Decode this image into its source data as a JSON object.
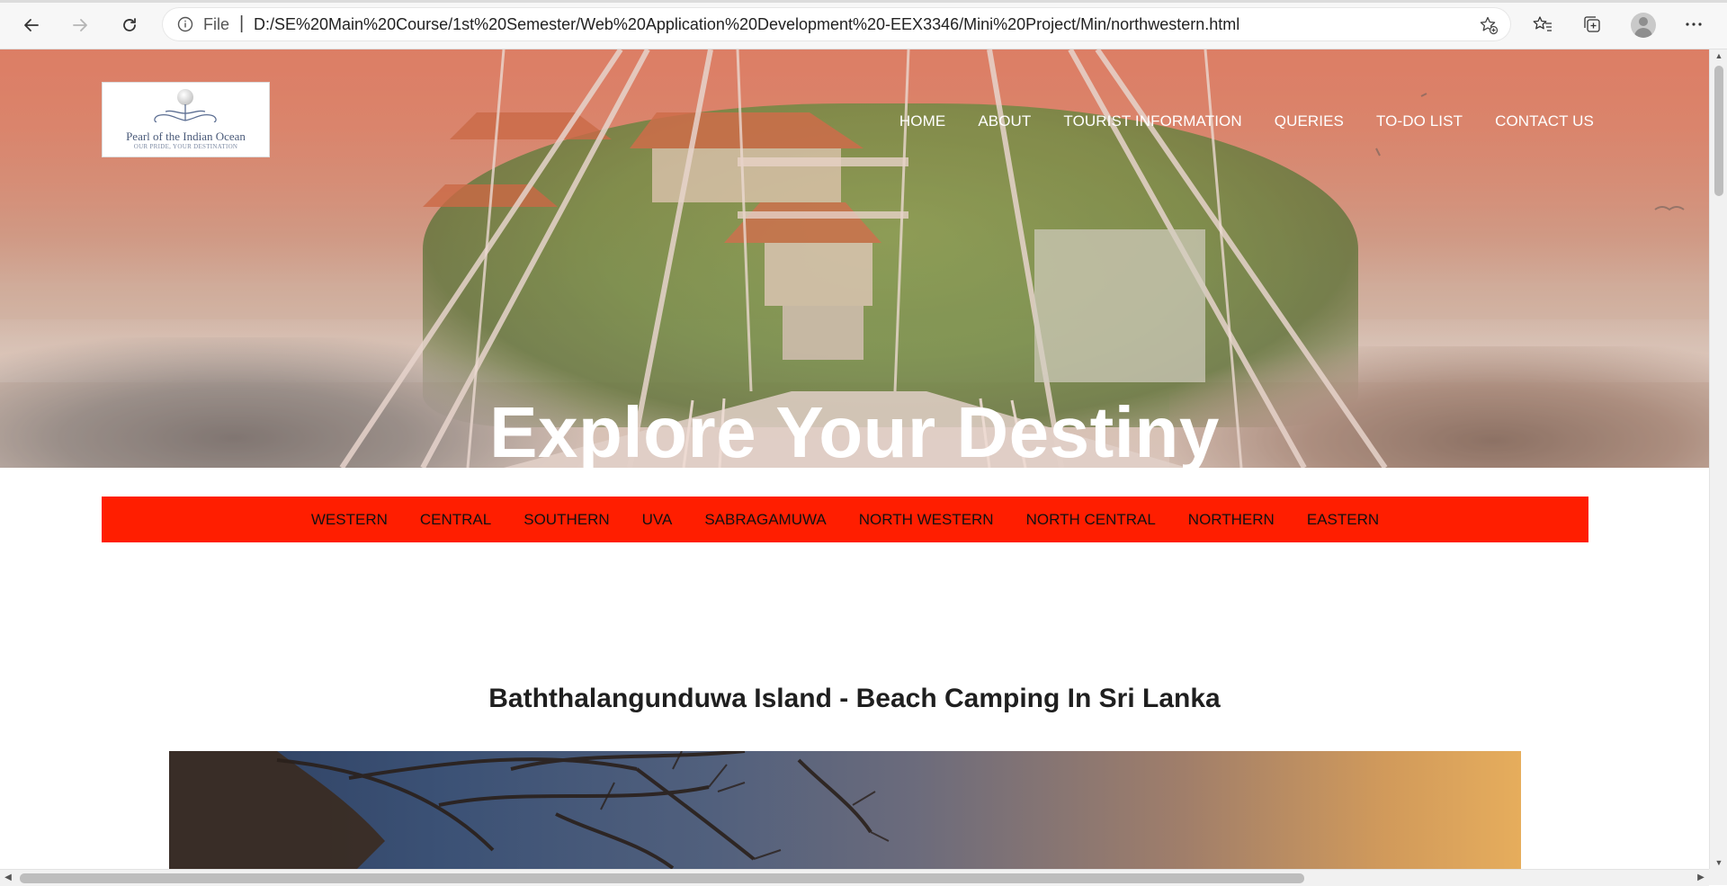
{
  "browser": {
    "address": {
      "scheme_label": "File",
      "separator": "|",
      "url": "D:/SE%20Main%20Course/1st%20Semester/Web%20Application%20Development%20-EEX3346/Mini%20Project/Min/northwestern.html"
    },
    "icons": [
      "back-icon",
      "forward-icon",
      "refresh-icon",
      "info-icon",
      "add-favorite-icon",
      "favorites-icon",
      "collections-icon",
      "profile-icon",
      "more-icon"
    ]
  },
  "site": {
    "logo": {
      "name": "Pearl of the Indian Ocean",
      "tagline": "OUR PRIDE, YOUR DESTINATION"
    },
    "nav": [
      {
        "label": "HOME"
      },
      {
        "label": "ABOUT"
      },
      {
        "label": "TOURIST INFORMATION"
      },
      {
        "label": "QUERIES"
      },
      {
        "label": "TO-DO LIST"
      },
      {
        "label": "CONTACT US"
      }
    ],
    "hero_title": "Explore Your Destiny",
    "provinces": [
      {
        "label": "WESTERN"
      },
      {
        "label": "CENTRAL"
      },
      {
        "label": "SOUTHERN"
      },
      {
        "label": "UVA"
      },
      {
        "label": "SABRAGAMUWA"
      },
      {
        "label": "NORTH WESTERN"
      },
      {
        "label": "NORTH CENTRAL"
      },
      {
        "label": "NORTHERN"
      },
      {
        "label": "EASTERN"
      }
    ],
    "section_title": "Baththalangunduwa Island - Beach Camping In Sri Lanka",
    "colors": {
      "province_bar": "#ff1e00",
      "hero_tint": "#d9816b",
      "text_white": "#ffffff"
    }
  }
}
